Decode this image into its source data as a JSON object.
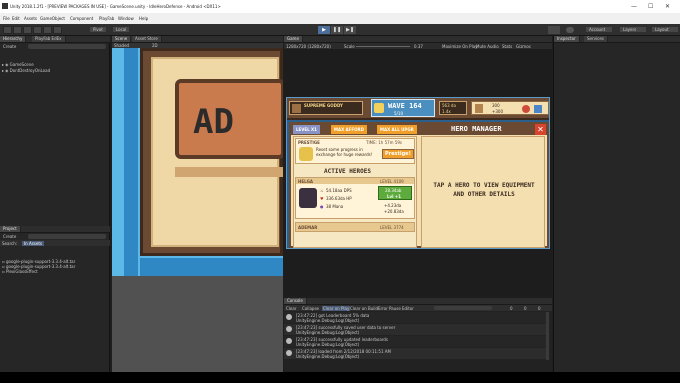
{
  "window": {
    "title": "Unity 2018.1.2f1 - [PREVIEW PACKAGES IN USE] - GameScene.unity - IdleHeroDefense - Android <DX11>"
  },
  "menu": [
    "File",
    "Edit",
    "Assets",
    "GameObject",
    "Component",
    "PlayFab",
    "Window",
    "Help"
  ],
  "toolbar": {
    "pivot": "Pivot",
    "local": "Local",
    "account": "Account",
    "layers": "Layers",
    "layout": "Layout"
  },
  "hierarchy": {
    "tab": "Hierarchy",
    "tab2": "PlayFab EdEx",
    "create": "Create",
    "items": [
      "GameScene",
      "DontDestroyOnLoad"
    ]
  },
  "project": {
    "tab": "Project",
    "create": "Create",
    "search_label": "Search:",
    "search_scope": "In Assets",
    "items": [
      "google-plugin-support-3.3.4-alt.tar",
      "google-plugin-support-3.3.4-alt.tar",
      "PlexiGlassEffect"
    ]
  },
  "scene": {
    "tab": "Scene",
    "tab2": "Asset Store",
    "shaded": "Shaded",
    "mode": "2D",
    "ad_text": "AD"
  },
  "game": {
    "tab": "Game",
    "resolution": "1280x720 (1280x720)",
    "scale_label": "Scale",
    "scale_value": "0.37",
    "options": [
      "Maximize On Play",
      "Mute Audio",
      "Stats",
      "Gizmos"
    ]
  },
  "hud": {
    "wave_label": "WAVE 164",
    "wave_sub": "5/10",
    "left_label": "SUPREME GODDY",
    "stat1": "563 da",
    "stat2": "1.4x",
    "stat3": "300",
    "stat4": "+300"
  },
  "hero_manager": {
    "title": "HERO MANAGER",
    "tabs": [
      "LEVEL X1",
      "MAX AFFORD",
      "MAX ALL UPGR"
    ],
    "prestige_title": "PRESTIGE",
    "prestige_time": "TIME: 1h 57m 59s",
    "prestige_text": "Reset some progress in exchange for huge rewards!",
    "prestige_button": "Prestige!",
    "active_heroes": "ACTIVE HEROES",
    "hero_name": "HELGA",
    "hero_level": "LEVEL 4109",
    "hero_stats": [
      "54.18aa DPS",
      "336.63da HP",
      "38 Mana"
    ],
    "upgrade_button": "Lvl +1",
    "upgrade_cost": "28.34ab",
    "bonus1": "+4.23da",
    "bonus2": "+20.83da",
    "hero2_name": "ADEMAR",
    "hero2_level": "LEVEL 3774",
    "tap_hint": "TAP A HERO TO VIEW EQUIPMENT AND OTHER DETAILS"
  },
  "inspector": {
    "tab": "Inspector",
    "tab2": "Services"
  },
  "console": {
    "tab": "Console",
    "buttons": [
      "Clear",
      "Collapse",
      "Clear on Play",
      "Clear on Build",
      "Error Pause",
      "Editor"
    ],
    "lines": [
      "[23:47:22] got Leaderboard 5% data",
      "UnityEngine.Debug:Log(Object)",
      "[23:47:23] successfully saved user data to server",
      "UnityEngine.Debug:Log(Object)",
      "[23:47:23] successfully updated leaderboards",
      "UnityEngine.Debug:Log(Object)",
      "[23:47:23] loaded from 2/12/2018 00:11:51 AM",
      "UnityEngine.Debug:Log(Object)"
    ],
    "counts": [
      "0",
      "0",
      "0"
    ]
  },
  "colors": {
    "editor_bg": "#1e1e1e",
    "panel_bg": "#282828",
    "game_bg": "#2b5f8c",
    "hud_brown": "#6b4a34",
    "parchment": "#f3dfb0",
    "orange_btn": "#f0a02a",
    "green_btn": "#5cab3c",
    "close_red": "#d8452f"
  }
}
